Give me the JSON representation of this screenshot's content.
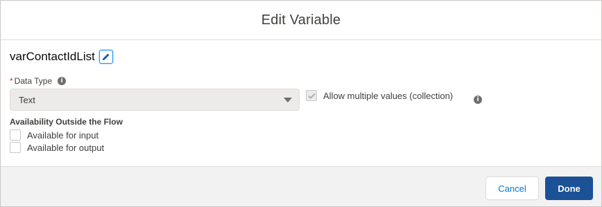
{
  "modal": {
    "title": "Edit Variable"
  },
  "variable": {
    "name": "varContactIdList"
  },
  "data_type": {
    "label": "Data Type",
    "required_marker": "*",
    "selected": "Text"
  },
  "collection": {
    "label": "Allow multiple values (collection)",
    "checked": true,
    "disabled": true
  },
  "availability": {
    "heading": "Availability Outside the Flow",
    "options": [
      {
        "label": "Available for input",
        "checked": false
      },
      {
        "label": "Available for output",
        "checked": false
      }
    ]
  },
  "footer": {
    "cancel_label": "Cancel",
    "done_label": "Done"
  },
  "icons": {
    "edit": "pencil-icon",
    "info": "info-icon",
    "dropdown": "chevron-down-icon",
    "check": "checkmark-icon"
  },
  "colors": {
    "brand_button": "#1b5297",
    "link": "#0176d3",
    "required": "#c23934",
    "focus": "#1b96ff"
  }
}
